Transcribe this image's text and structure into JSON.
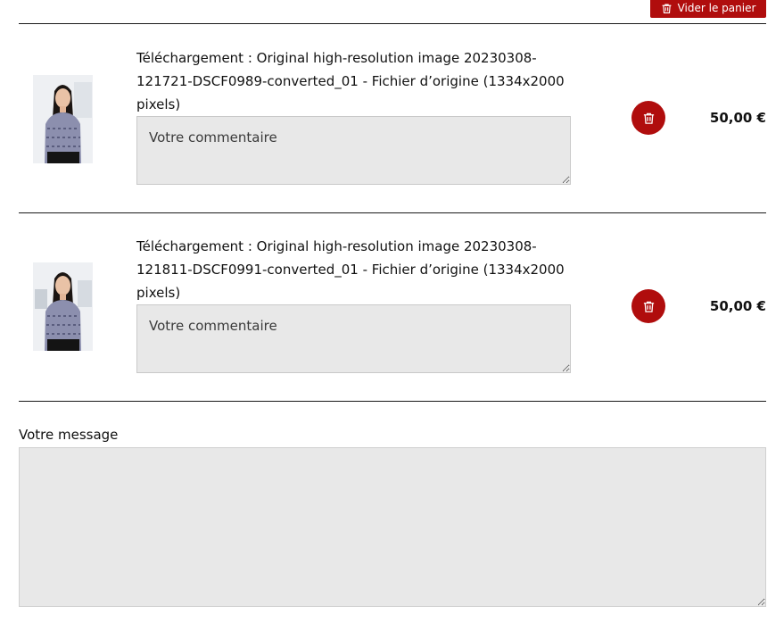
{
  "colors": {
    "accent": "#b00d0d",
    "text": "#111111",
    "field_bg": "#e8e8e8"
  },
  "cart": {
    "empty_cart_label": "Vider le panier",
    "empty_cart_icon": "trash-icon",
    "items": [
      {
        "title": "Téléchargement : Original high-resolution image 20230308-121721-DSCF0989-converted_01 - Fichier d’origine (1334x2000 pixels)",
        "comment_placeholder": "Votre commentaire",
        "price": "50,00 €",
        "thumbnail": "portrait-photo"
      },
      {
        "title": "Téléchargement : Original high-resolution image 20230308-121811-DSCF0991-converted_01 - Fichier d’origine (1334x2000 pixels)",
        "comment_placeholder": "Votre commentaire",
        "price": "50,00 €",
        "thumbnail": "portrait-photo"
      }
    ]
  },
  "message": {
    "label": "Votre message",
    "value": ""
  }
}
